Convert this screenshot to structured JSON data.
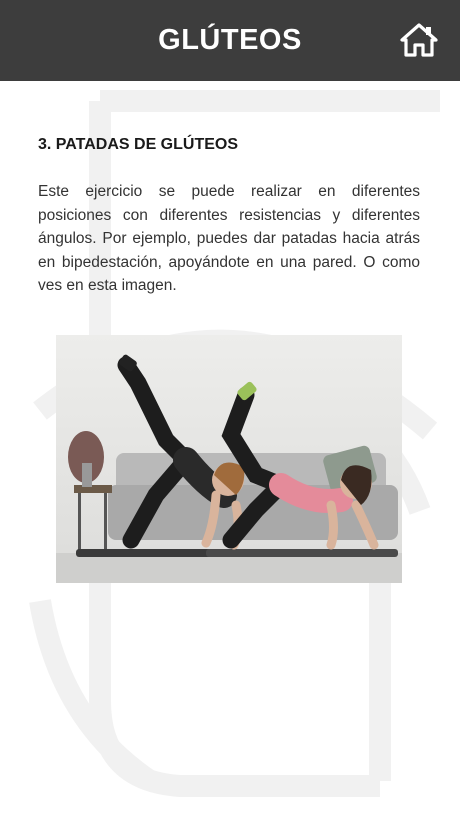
{
  "header": {
    "title": "GLÚTEOS",
    "home_icon": "home-icon",
    "background": "#3d3d3d"
  },
  "article": {
    "heading": "3. PATADAS DE GLÚTEOS",
    "body": "Este ejercicio se puede realizar en diferentes posiciones con diferentes resistencias y diferentes ángulos. Por ejemplo, puedes dar patadas hacia atrás en bipedestación, apoyándote en una pared. O como ves en esta imagen."
  },
  "image": {
    "subject": "two-women-doing-glute-kickbacks-on-mats"
  }
}
